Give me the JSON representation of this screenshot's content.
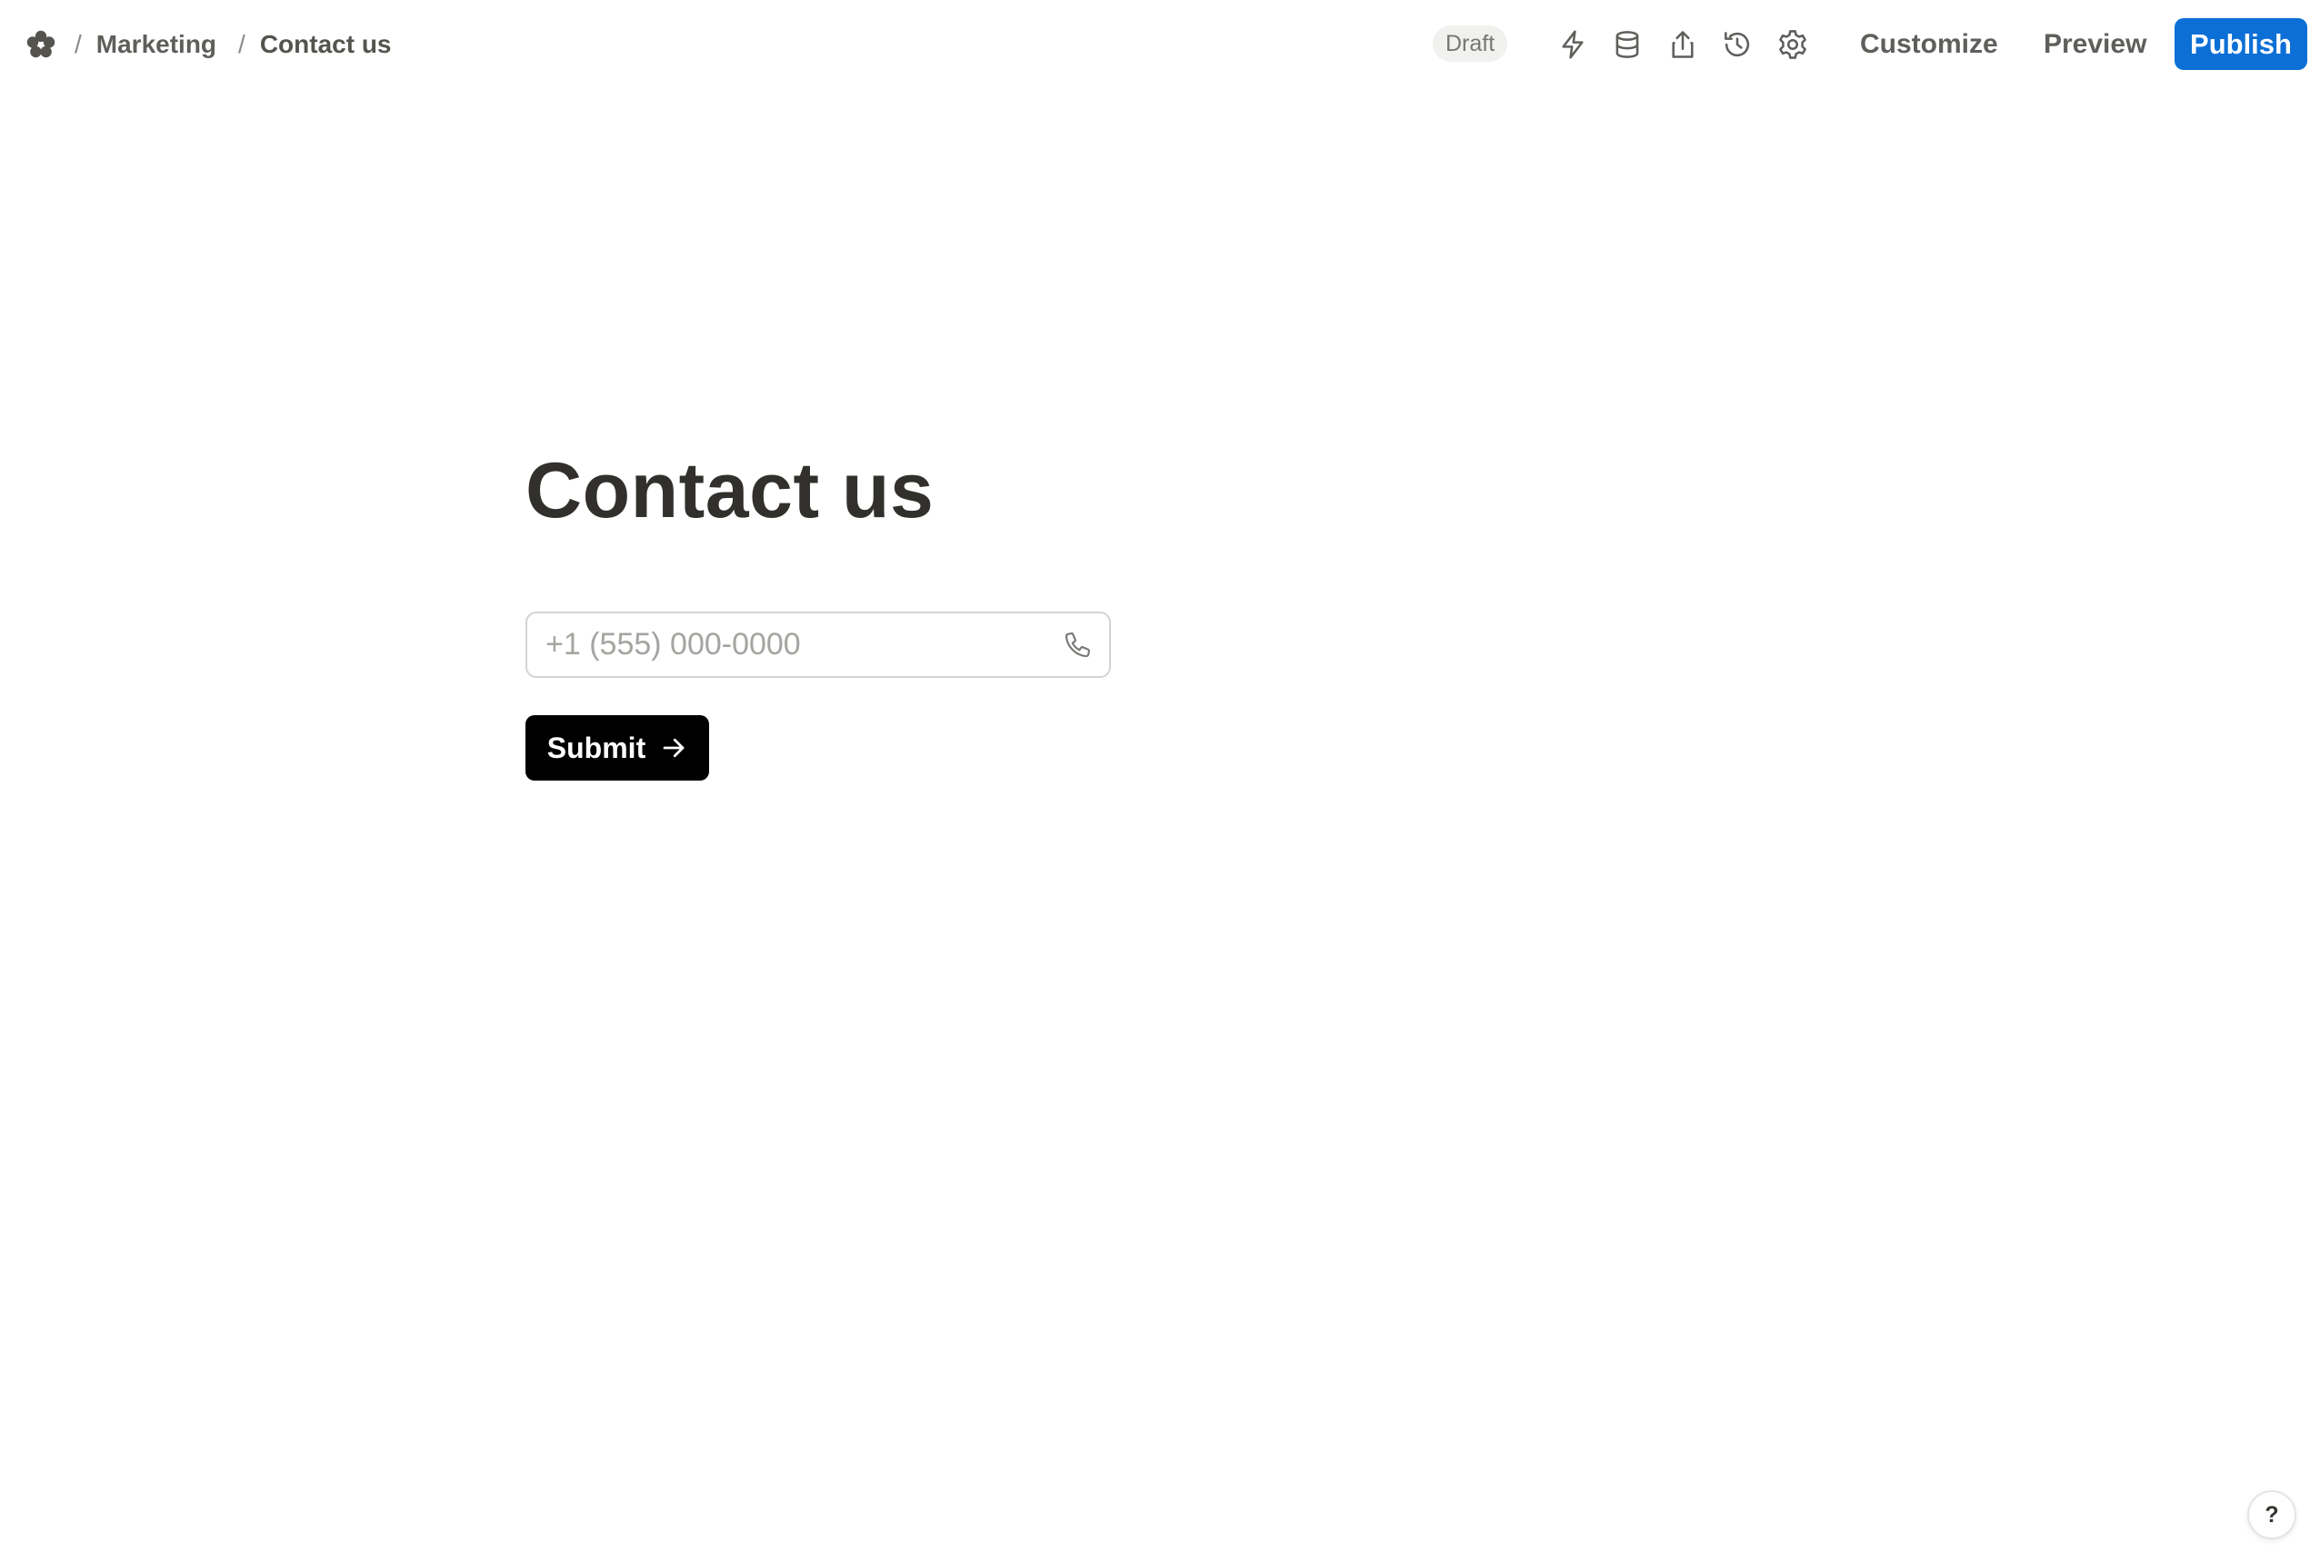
{
  "breadcrumb": {
    "separator": "/",
    "items": [
      "Marketing",
      "Contact us"
    ]
  },
  "header": {
    "status_badge": "Draft",
    "icons": [
      "lightning-icon",
      "database-icon",
      "share-icon",
      "history-icon",
      "settings-icon"
    ],
    "customize_label": "Customize",
    "preview_label": "Preview",
    "publish_label": "Publish"
  },
  "form": {
    "title": "Contact us",
    "phone_placeholder": "+1 (555) 000-0000",
    "phone_value": "",
    "submit_label": "Submit"
  },
  "help": {
    "label": "?"
  },
  "colors": {
    "accent": "#0b6fd6",
    "submit_background": "#000000",
    "badge_background": "#f1f1ef"
  }
}
